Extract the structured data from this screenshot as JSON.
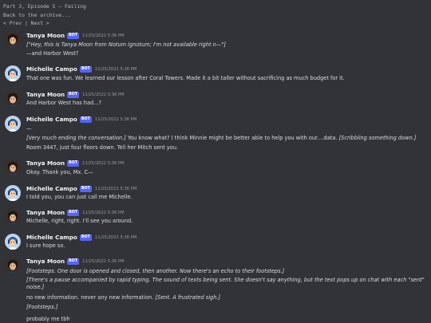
{
  "header": {
    "title": "Part 3, Episode 5 — Failing",
    "back_link": "Back to the archive...",
    "prev": "< Prev",
    "sep": "|",
    "next": "Next >"
  },
  "bot_badge": "BOT",
  "messages": [
    {
      "author": "Tanya Moon",
      "avatar": "tanya",
      "time": "11/25/2022 5:36 PM",
      "lines": [
        [
          {
            "t": "[\"Hey, this is Tanya Moon from Notum Ignotum; I'm not available right n—\"]",
            "i": true
          }
        ],
        [
          {
            "t": "—and Harbor West?",
            "i": false
          }
        ]
      ]
    },
    {
      "author": "Michelle Campo",
      "avatar": "michelle",
      "time": "11/25/2022 5:36 PM",
      "lines": [
        [
          {
            "t": "That one was fun. We learned our lesson after Coral Towers. Made it a bit taller without sacrificing as much budget for it.",
            "i": false
          }
        ]
      ]
    },
    {
      "author": "Tanya Moon",
      "avatar": "tanya",
      "time": "11/25/2022 5:36 PM",
      "lines": [
        [
          {
            "t": "And Harbor West has had...?",
            "i": false
          }
        ]
      ]
    },
    {
      "author": "Michelle Campo",
      "avatar": "michelle",
      "time": "11/25/2022 5:36 PM",
      "lines": [
        [
          {
            "t": "—",
            "i": false
          }
        ],
        [
          {
            "t": "[Very much ending the conversation.]",
            "i": true
          },
          {
            "t": " You know what? I think Minnie might be better able to help you with our....data. ",
            "i": false
          },
          {
            "t": "[Scribbling something down.]",
            "i": true
          }
        ],
        [
          {
            "t": "Room 3447, just four floors down. Tell her Mitch sent you.",
            "i": false
          }
        ]
      ]
    },
    {
      "author": "Tanya Moon",
      "avatar": "tanya",
      "time": "11/25/2022 5:36 PM",
      "lines": [
        [
          {
            "t": "Okay. Thank you, Mx. C—",
            "i": false
          }
        ]
      ]
    },
    {
      "author": "Michelle Campo",
      "avatar": "michelle",
      "time": "11/25/2022 5:36 PM",
      "lines": [
        [
          {
            "t": "I told you, you can just call me Michelle.",
            "i": false
          }
        ]
      ]
    },
    {
      "author": "Tanya Moon",
      "avatar": "tanya",
      "time": "11/25/2022 5:36 PM",
      "lines": [
        [
          {
            "t": "Michelle, right, right. I'll see you around.",
            "i": false
          }
        ]
      ]
    },
    {
      "author": "Michelle Campo",
      "avatar": "michelle",
      "time": "11/25/2022 5:36 PM",
      "lines": [
        [
          {
            "t": "I sure hope so.",
            "i": false
          }
        ]
      ]
    },
    {
      "author": "Tanya Moon",
      "avatar": "tanya",
      "time": "11/25/2022 5:36 PM",
      "lines": [
        [
          {
            "t": "[Footsteps. One door is opened and closed, then another. Now there's an echo to their footsteps.]",
            "i": true
          }
        ],
        [
          {
            "t": "[There's a pause accompanied by rapid typing. The sound of texts being sent. She doesn't say anything, but the text pops up on chat with each \"sent\" noise.]",
            "i": true,
            "wrap": true
          }
        ],
        [
          {
            "t": "no new information. never any new information. ",
            "i": false
          },
          {
            "t": "[Sent. A frustrated sigh.]",
            "i": true
          }
        ],
        [
          {
            "t": "[Footsteps.]",
            "i": true
          }
        ],
        [
          {
            "t": "probably me tbh",
            "i": false
          }
        ]
      ]
    }
  ],
  "colors": {
    "background": "#313338",
    "bot_badge": "#5865f2",
    "text": "#dbdee1",
    "timestamp": "#949ba4"
  }
}
